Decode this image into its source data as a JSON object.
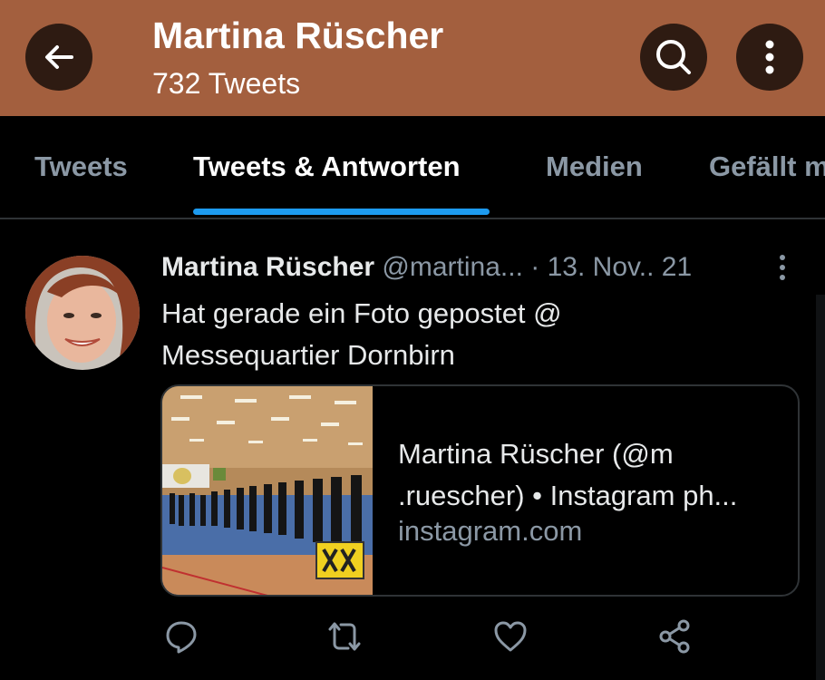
{
  "header": {
    "title": "Martina Rüscher",
    "subtitle": "732 Tweets"
  },
  "tabs": [
    {
      "label": "Tweets",
      "active": false
    },
    {
      "label": "Tweets & Antworten",
      "active": true
    },
    {
      "label": "Medien",
      "active": false
    },
    {
      "label": "Gefällt mir",
      "active": false
    }
  ],
  "tweet": {
    "name": "Martina Rüscher",
    "handle": "@martina...",
    "separator": "·",
    "date": "13. Nov.. 21",
    "text": "Hat gerade ein Foto gepostet @ Messequartier Dornbirn",
    "card": {
      "title": "Martina Rüscher (@m .ruescher) • Instagram ph...",
      "domain": "instagram.com"
    }
  },
  "icons": {
    "back": "arrow-left-icon",
    "search": "search-icon",
    "more": "more-vertical-icon",
    "reply": "reply-icon",
    "retweet": "retweet-icon",
    "like": "heart-icon",
    "share": "share-icon"
  },
  "colors": {
    "header_bg": "#a35f3e",
    "header_button_bg": "#2e1b12",
    "tab_indicator": "#1d9bf0",
    "background": "#000000",
    "secondary_text": "#8b98a5"
  }
}
